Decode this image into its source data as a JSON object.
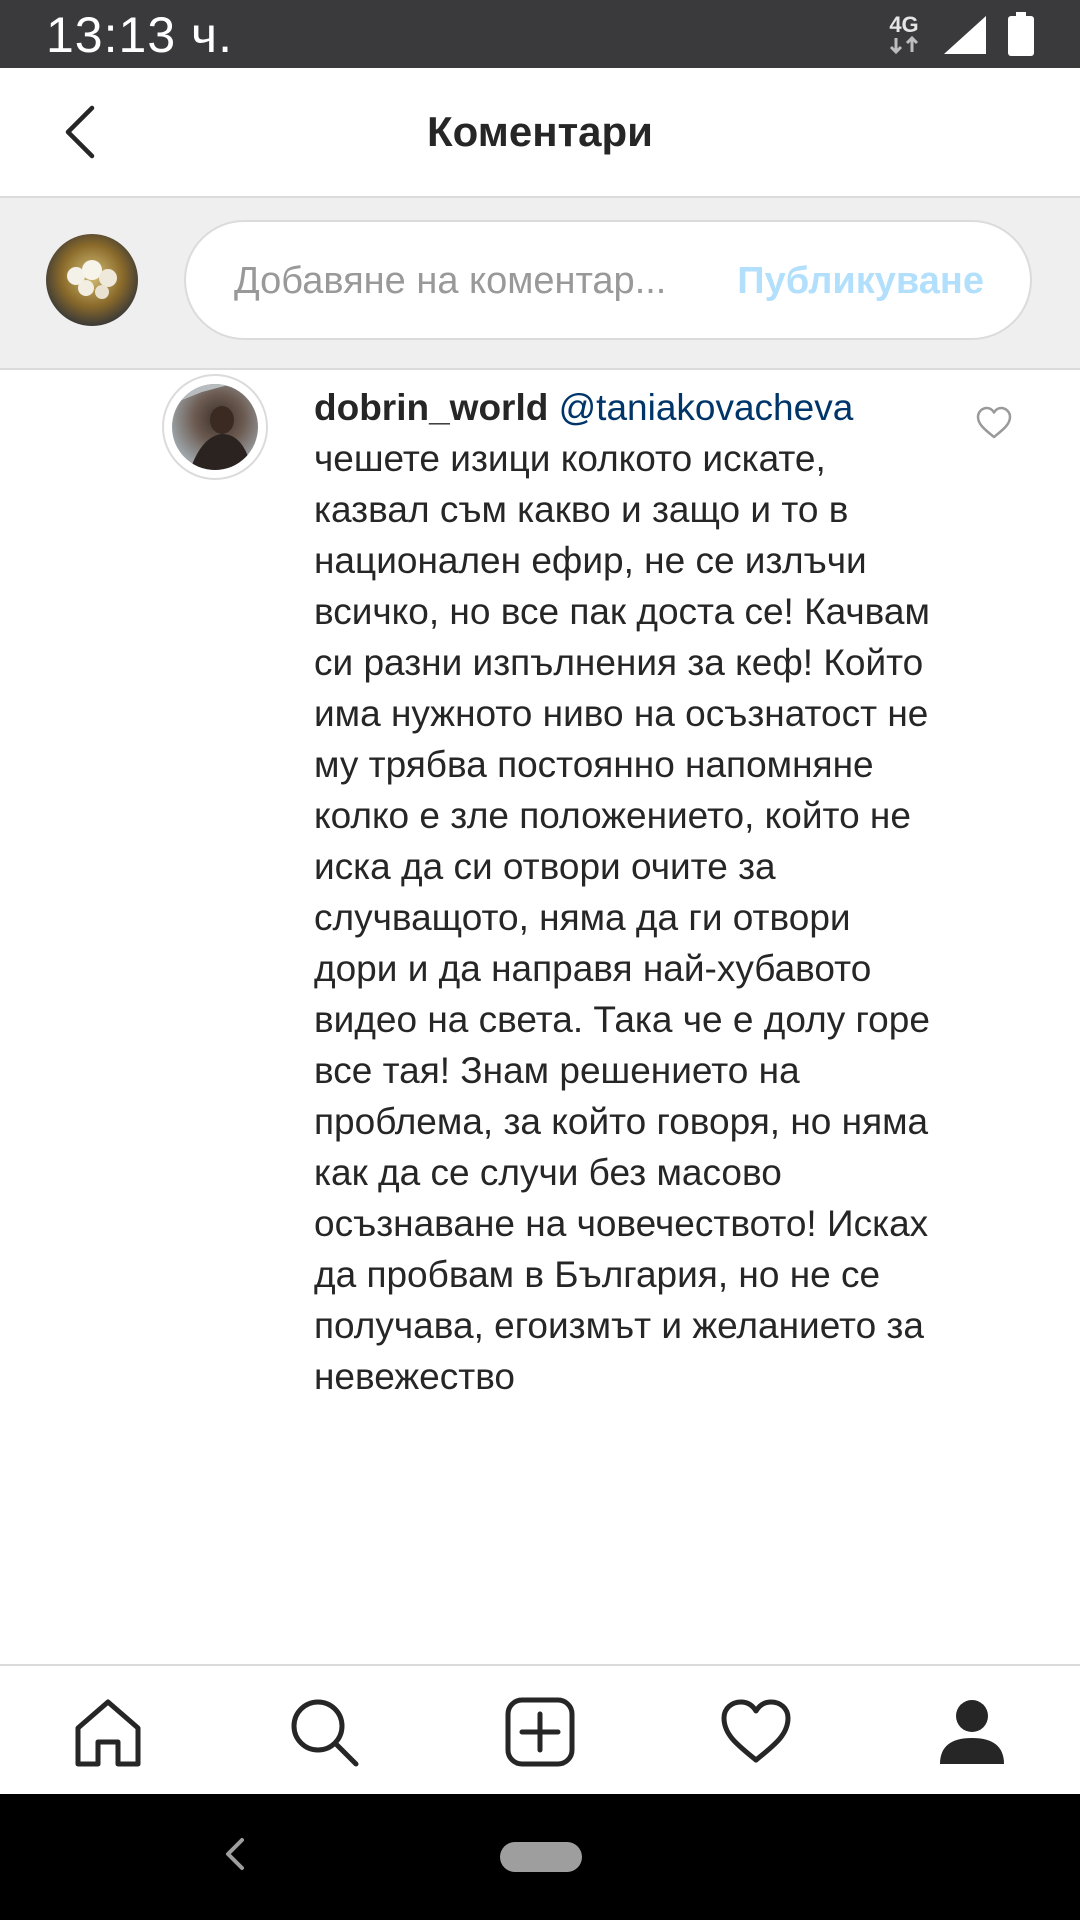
{
  "status_bar": {
    "time": "13:13 ч.",
    "network": "4G",
    "icons": [
      "signal-icon",
      "battery-icon"
    ]
  },
  "header": {
    "title": "Коментари",
    "back_icon": "back-arrow-icon"
  },
  "composer": {
    "placeholder": "Добавяне на коментар...",
    "publish_label": "Публикуване"
  },
  "comment": {
    "username": "dobrin_world",
    "mention": "@taniakovacheva",
    "text": "чешете изици колкото искате, казвал съм какво и защо и то в национален ефир, не се излъчи всичко, но все пак доста се! Качвам си разни изпълнения за кеф! Който има нужното ниво на осъзнатост не му трябва постоянно напомняне колко е зле положението, който не иска да си отвори очите за случващото, няма да ги отвори дори и да направя най-хубавото видео на света. Така че е долу горе все тая! Знам решението на проблема, за който говоря, но няма как да се случи без масово осъзнаване на човечеството! Исках да пробвам в България, но не се получава, егоизмът и желанието за невежество",
    "like_icon": "heart-outline-icon"
  },
  "bottom_nav": [
    "home-icon",
    "search-icon",
    "new-post-icon",
    "activity-heart-icon",
    "profile-icon"
  ],
  "colors": {
    "status_bar": "#3a3a3c",
    "publish_disabled": "#b2dffc",
    "mention": "#003569",
    "divider": "#dbdbdb"
  }
}
